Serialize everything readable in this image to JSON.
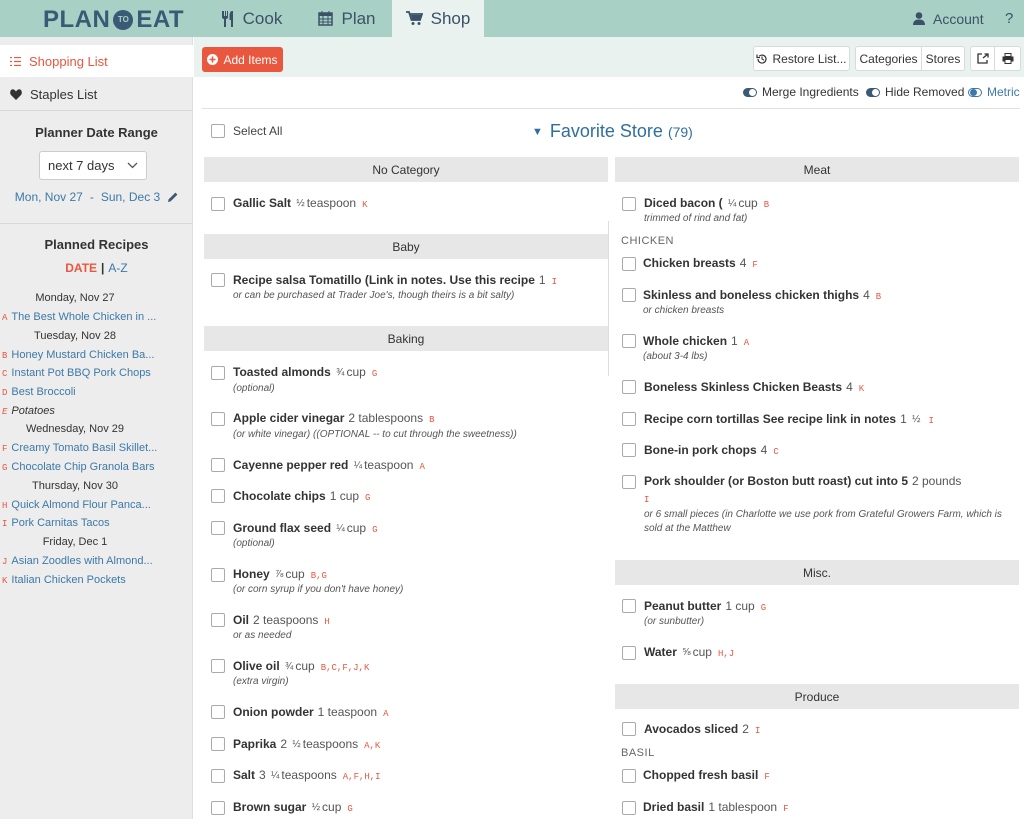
{
  "app": {
    "logo_left": "PLAN",
    "logo_mid": "TO",
    "logo_right": "EAT"
  },
  "nav": {
    "cook": "Cook",
    "plan": "Plan",
    "shop": "Shop",
    "account": "Account",
    "help": "?"
  },
  "sidebar": {
    "shopping_list": "Shopping List",
    "staples_list": "Staples List",
    "date_range_title": "Planner Date Range",
    "date_select": "next 7 days",
    "range_start": "Mon, Nov 27",
    "range_dash": "-",
    "range_end": "Sun, Dec 3",
    "planned_title": "Planned Recipes",
    "sort_date": "DATE",
    "sort_sep": "|",
    "sort_az": "A-Z",
    "days": [
      "Monday, Nov 27",
      "Tuesday, Nov 28",
      "Wednesday, Nov 29",
      "Thursday, Nov 30",
      "Friday, Dec 1"
    ],
    "recipes": [
      {
        "letter": "A",
        "name": "The Best Whole Chicken in ..."
      },
      {
        "letter": "B",
        "name": "Honey Mustard Chicken Ba..."
      },
      {
        "letter": "C",
        "name": "Instant Pot BBQ Pork Chops"
      },
      {
        "letter": "D",
        "name": "Best Broccoli"
      },
      {
        "letter": "E",
        "name": "Potatoes"
      },
      {
        "letter": "F",
        "name": "Creamy Tomato Basil Skillet..."
      },
      {
        "letter": "G",
        "name": "Chocolate Chip Granola Bars"
      },
      {
        "letter": "H",
        "name": "Quick Almond Flour Panca..."
      },
      {
        "letter": "I",
        "name": "Pork Carnitas Tacos"
      },
      {
        "letter": "J",
        "name": "Asian Zoodles with Almond..."
      },
      {
        "letter": "K",
        "name": "Italian Chicken Pockets"
      }
    ]
  },
  "toolbar": {
    "add_items": "Add Items",
    "restore_list": "Restore List...",
    "categories": "Categories",
    "stores": "Stores",
    "merge": "Merge Ingredients",
    "hide_removed": "Hide Removed",
    "metric": "Metric"
  },
  "list": {
    "select_all": "Select All",
    "store_name": "Favorite Store",
    "store_count": "(79)",
    "categories": {
      "no_category": "No Category",
      "baby": "Baby",
      "baking": "Baking",
      "meat": "Meat",
      "misc": "Misc.",
      "produce": "Produce"
    },
    "subheaders": {
      "chicken": "CHICKEN",
      "basil": "BASIL"
    },
    "items": {
      "gallic_salt": {
        "name": "Gallic Salt",
        "frac": "½",
        "qty": "teaspoon",
        "tags": "K"
      },
      "salsa": {
        "name": "Recipe salsa Tomatillo (Link in notes. Use this recipe",
        "qty": "1",
        "tags": "I",
        "note": "or can be purchased at Trader Joe's, though theirs is a bit salty)"
      },
      "almonds": {
        "name": "Toasted almonds",
        "frac": "¾",
        "qty": "cup",
        "tags": "G",
        "note": "(optional)"
      },
      "vinegar": {
        "name": "Apple cider vinegar",
        "qty": "2 tablespoons",
        "tags": "B",
        "note": "(or white vinegar) ((OPTIONAL -- to cut through the sweetness))"
      },
      "cayenne": {
        "name": "Cayenne pepper red",
        "frac": "¼",
        "qty": "teaspoon",
        "tags": "A"
      },
      "chips": {
        "name": "Chocolate chips",
        "qty": "1 cup",
        "tags": "G"
      },
      "flax": {
        "name": "Ground flax seed",
        "frac": "¼",
        "qty": "cup",
        "tags": "G",
        "note": "(optional)"
      },
      "honey": {
        "name": "Honey",
        "frac": "⅞",
        "qty": "cup",
        "tags": "B,G",
        "note": "(or corn syrup if you don't have honey)"
      },
      "oil": {
        "name": "Oil",
        "qty": "2 teaspoons",
        "tags": "H",
        "note": "or as needed"
      },
      "olive_oil": {
        "name": "Olive oil",
        "frac": "¾",
        "qty": "cup",
        "tags": "B,C,F,J,K",
        "note": "(extra virgin)"
      },
      "onion_powder": {
        "name": "Onion powder",
        "qty": "1 teaspoon",
        "tags": "A"
      },
      "paprika": {
        "name": "Paprika",
        "whole": "2",
        "frac": "½",
        "qty": "teaspoons",
        "tags": "A,K"
      },
      "salt": {
        "name": "Salt",
        "whole": "3",
        "frac": "¼",
        "qty": "teaspoons",
        "tags": "A,F,H,I"
      },
      "brown_sugar": {
        "name": "Brown sugar",
        "frac": "½",
        "qty": "cup",
        "tags": "G"
      },
      "bacon": {
        "name": "Diced bacon (",
        "frac": "¼",
        "qty": "cup",
        "tags": "B",
        "note": "trimmed of rind and fat)"
      },
      "chicken_breasts": {
        "name": "Chicken breasts",
        "qty": "4",
        "tags": "F"
      },
      "thighs": {
        "name": "Skinless and boneless chicken thighs",
        "qty": "4",
        "tags": "B",
        "note": "or chicken breasts"
      },
      "whole_chicken": {
        "name": "Whole chicken",
        "qty": "1",
        "tags": "A",
        "note": "(about 3-4 lbs)"
      },
      "boneless_breasts": {
        "name": "Boneless Skinless Chicken Beasts",
        "qty": "4",
        "tags": "K"
      },
      "tortillas": {
        "name": "Recipe corn tortillas See recipe link in notes",
        "whole": "1",
        "frac": "½",
        "tags": "I"
      },
      "pork_chops": {
        "name": "Bone-in pork chops",
        "qty": "4",
        "tags": "C"
      },
      "pork_shoulder": {
        "name": "Pork shoulder (or Boston butt roast) cut into 5",
        "qty": "2 pounds",
        "tags": "I",
        "note1": "or 6 small pieces (in Charlotte we use pork from Grateful Growers Farm, which is",
        "note2": "sold at the Matthew"
      },
      "peanut_butter": {
        "name": "Peanut butter",
        "qty": "1 cup",
        "tags": "G",
        "note": "(or sunbutter)"
      },
      "water": {
        "name": "Water",
        "frac": "⅝",
        "qty": "cup",
        "tags": "H,J"
      },
      "avocados": {
        "name": "Avocados sliced",
        "qty": "2",
        "tags": "I"
      },
      "chopped_basil": {
        "name": "Chopped fresh basil",
        "tags": "F"
      },
      "dried_basil": {
        "name": "Dried basil",
        "qty": "1 tablespoon",
        "tags": "F"
      }
    }
  },
  "colors": {
    "topbar": "#a9d0c5",
    "brand_navy": "#3a5a75",
    "accent": "#e8573e",
    "link": "#3c79a8",
    "store_title": "#2f6fa0"
  }
}
